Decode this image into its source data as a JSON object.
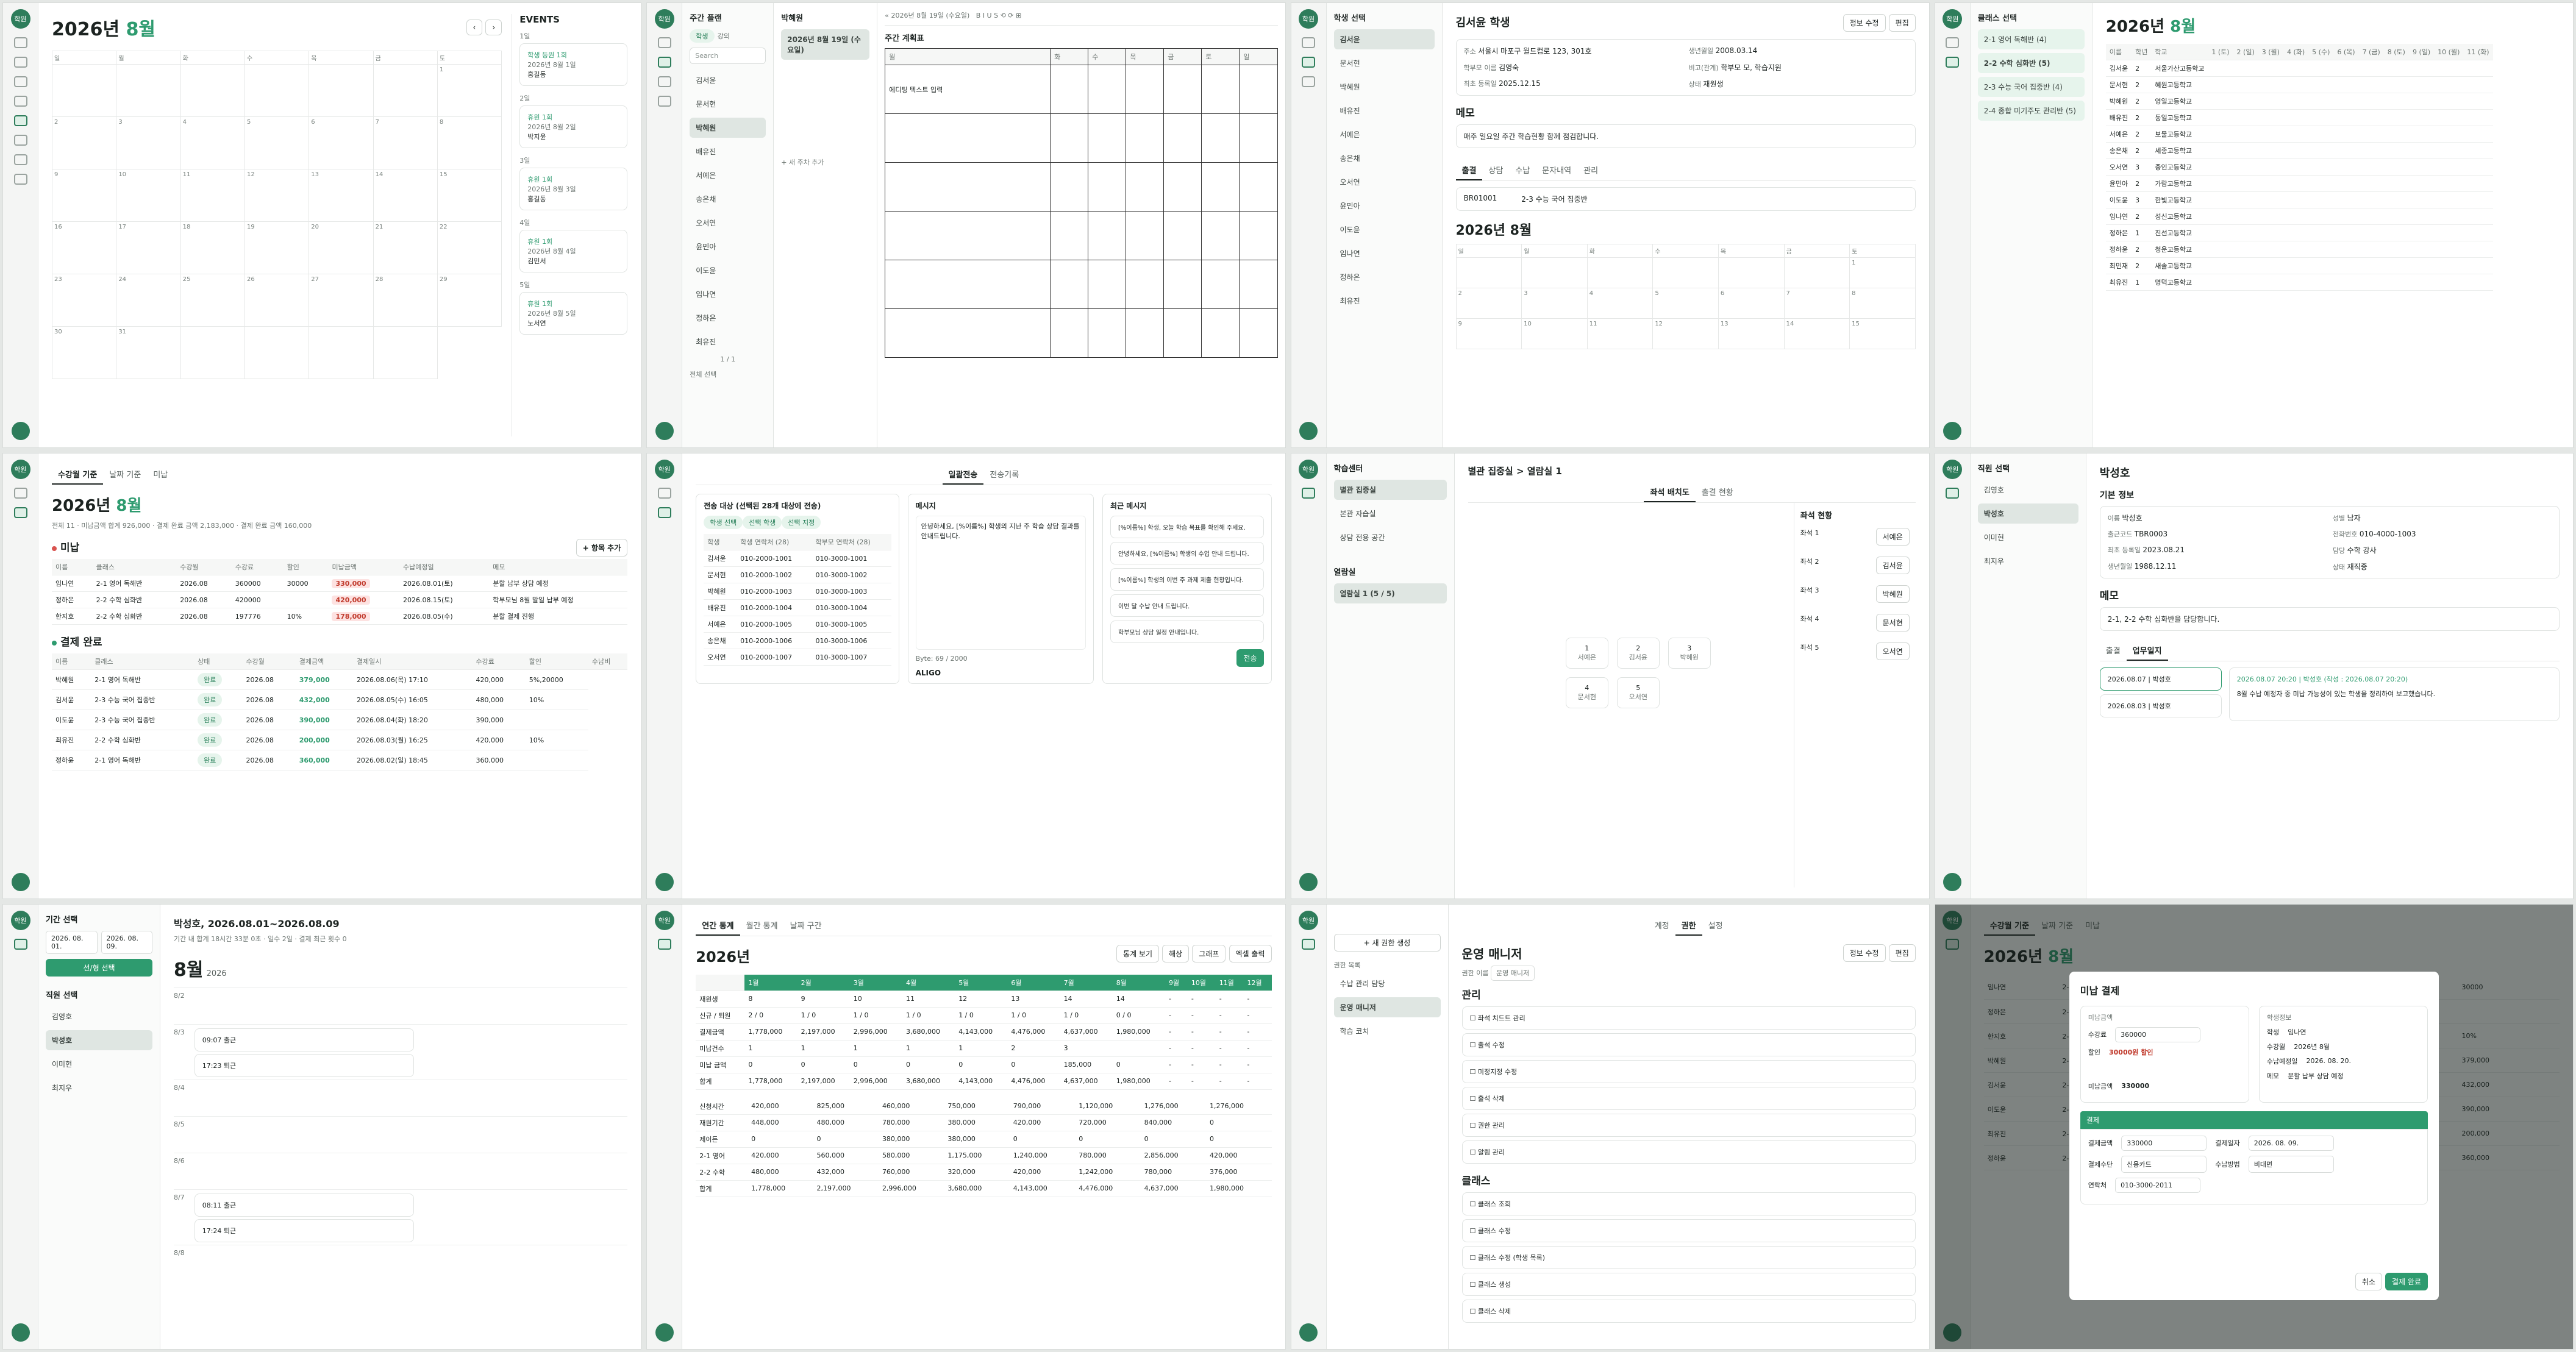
{
  "rail": {
    "logo": "학원"
  },
  "p1": {
    "year": "2026년",
    "month": "8월",
    "events_title": "EVENTS",
    "weekdays": [
      "일",
      "월",
      "화",
      "수",
      "목",
      "금",
      "토"
    ],
    "days": [
      "",
      "",
      "",
      "",
      "",
      "",
      "1",
      "2",
      "3",
      "4",
      "5",
      "6",
      "7",
      "8",
      "9",
      "10",
      "11",
      "12",
      "13",
      "14",
      "15",
      "16",
      "17",
      "18",
      "19",
      "20",
      "21",
      "22",
      "23",
      "24",
      "25",
      "26",
      "27",
      "28",
      "29",
      "30",
      "31",
      "",
      "",
      "",
      ""
    ],
    "events": [
      {
        "date": "1일",
        "name": "학생 등원 1회",
        "when": "2026년 8월 1일",
        "who": "홍길동"
      },
      {
        "date": "2일",
        "name": "휴원 1회",
        "when": "2026년 8월 2일",
        "who": "박지윤"
      },
      {
        "date": "3일",
        "name": "휴원 1회",
        "when": "2026년 8월 3일",
        "who": "홍길동"
      },
      {
        "date": "4일",
        "name": "휴원 1회",
        "when": "2026년 8월 4일",
        "who": "김민서"
      },
      {
        "date": "5일",
        "name": "휴원 1회",
        "when": "2026년 8월 5일",
        "who": "노서연"
      }
    ]
  },
  "p2": {
    "title": "주간 플랜",
    "student": "박혜원",
    "toolbar_date": "2026년 8월 19일 (수요일)",
    "tabs": [
      "학생",
      "강의"
    ],
    "search_placeholder": "Search",
    "students": [
      "김서윤",
      "문서현",
      "박혜원",
      "배유진",
      "서예은",
      "송은채",
      "오서연",
      "윤민아",
      "이도윤",
      "임나연",
      "정하은",
      "최유진"
    ],
    "pager": "1 / 1",
    "plan_title": "주간 계획표",
    "cell_label": "에디팅 텍스트 입력",
    "all_select": "전체 선택",
    "add": "+ 새 주차 추가",
    "days": [
      "월",
      "화",
      "수",
      "목",
      "금",
      "토",
      "일"
    ]
  },
  "p3": {
    "title": "김서윤 학생",
    "side_title": "학생 선택",
    "students": [
      "김서윤",
      "문서현",
      "박혜원",
      "배유진",
      "서예은",
      "송은채",
      "오서연",
      "윤민아",
      "이도윤",
      "임나연",
      "정하은",
      "최유진"
    ],
    "info": [
      {
        "k": "주소",
        "v": "서울시 마포구 월드컵로 123, 301호"
      },
      {
        "k": "생년월일",
        "v": "2008.03.14"
      },
      {
        "k": "학부모 이름",
        "v": "김영숙"
      },
      {
        "k": "비고(관계)",
        "v": "학부모 모, 학습지원"
      },
      {
        "k": "최초 등록일",
        "v": "2025.12.15"
      },
      {
        "k": "상태",
        "v": "재원생"
      }
    ],
    "memo_title": "메모",
    "memo": "매주 일요일 주간 학습현황 함께 점검합니다.",
    "tabs": [
      "출결",
      "상담",
      "수납",
      "문자내역",
      "관리"
    ],
    "code": "BR01001",
    "klass": "2-3 수능 국어 집중반",
    "cal_title": "2026년 8월",
    "btn_edit": "정보 수정",
    "btn_save": "편집"
  },
  "p4": {
    "side_title": "클래스 선택",
    "classes": [
      "2-1 영어 독해반 (4)",
      "2-2 수학 심화반 (5)",
      "2-3 수능 국어 집중반 (4)",
      "2-4 종합 미기주도 관리반 (5)"
    ],
    "title_year": "2026년",
    "title_month": "8월",
    "headers": [
      "이름",
      "학년",
      "학교",
      "1 (토)",
      "2 (일)",
      "3 (월)",
      "4 (화)",
      "5 (수)",
      "6 (목)",
      "7 (금)",
      "8 (토)",
      "9 (일)",
      "10 (월)",
      "11 (화)"
    ],
    "rows": [
      [
        "김서윤",
        "2",
        "서울가산고등학교"
      ],
      [
        "문서현",
        "2",
        "혜원고등학교"
      ],
      [
        "박혜원",
        "2",
        "영일고등학교"
      ],
      [
        "배유진",
        "2",
        "동일고등학교"
      ],
      [
        "서예은",
        "2",
        "보물고등학교"
      ],
      [
        "송은채",
        "2",
        "세종고등학교"
      ],
      [
        "오서연",
        "3",
        "중인고등학교"
      ],
      [
        "윤민아",
        "2",
        "가람고등학교"
      ],
      [
        "이도윤",
        "3",
        "한빛고등학교"
      ],
      [
        "임나연",
        "2",
        "성신고등학교"
      ],
      [
        "정하은",
        "1",
        "진선고등학교"
      ],
      [
        "정하윤",
        "2",
        "청운고등학교"
      ],
      [
        "최민재",
        "2",
        "새솔고등학교"
      ],
      [
        "최유진",
        "1",
        "명덕고등학교"
      ]
    ]
  },
  "p5": {
    "tabs": [
      "수강월 기준",
      "날짜 기준",
      "미납"
    ],
    "title_year": "2026년",
    "title_month": "8월",
    "stats": "전체 11 · 미납금액 합계 926,000 · 결제 완료 금액 2,183,000 · 결제 완료 금액 160,000",
    "unpaid_title": "미납",
    "unpaid_count": "미납 3",
    "headers": [
      "이름",
      "클래스",
      "수강월",
      "수강료",
      "할인",
      "미납금액",
      "수납예정일",
      "메모"
    ],
    "unpaid": [
      [
        "임나연",
        "2-1 영어 독해반",
        "2026.08",
        "360000",
        "30000",
        "330,000",
        "2026.08.01(토)",
        "분할 납부 상담 예정"
      ],
      [
        "정하은",
        "2-2 수학 심화반",
        "2026.08",
        "420000",
        "",
        "420,000",
        "2026.08.15(토)",
        "학부모님 8월 말일 납부 예정"
      ],
      [
        "한지호",
        "2-2 수학 심화반",
        "2026.08",
        "197776",
        "10%",
        "178,000",
        "2026.08.05(수)",
        "분할 결제 진행"
      ]
    ],
    "paid_title": "결제 완료",
    "paid_headers": [
      "이름",
      "클래스",
      "상태",
      "수강월",
      "결제금액",
      "결제일시",
      "수강료",
      "할인",
      "수납비"
    ],
    "paid": [
      [
        "박혜원",
        "2-1 영어 독해반",
        "완료",
        "2026.08",
        "379,000",
        "2026.08.06(목) 17:10",
        "420,000",
        "5%,20000"
      ],
      [
        "김서윤",
        "2-3 수능 국어 집중반",
        "완료",
        "2026.08",
        "432,000",
        "2026.08.05(수) 16:05",
        "480,000",
        "10%"
      ],
      [
        "이도윤",
        "2-3 수능 국어 집중반",
        "완료",
        "2026.08",
        "390,000",
        "2026.08.04(화) 18:20",
        "390,000",
        ""
      ],
      [
        "최유진",
        "2-2 수학 심화반",
        "완료",
        "2026.08",
        "200,000",
        "2026.08.03(월) 16:25",
        "420,000",
        "10%"
      ],
      [
        "정하윤",
        "2-1 영어 독해반",
        "완료",
        "2026.08",
        "360,000",
        "2026.08.02(일) 18:45",
        "360,000",
        ""
      ]
    ],
    "add_btn": "+ 항목 추가"
  },
  "p6": {
    "tabs": [
      "일괄전송",
      "전송기록"
    ],
    "target_title": "전송 대상 (선택된 28개 대상에 전송)",
    "subtabs": [
      "학생 선택",
      "선택 학생",
      "선택 지정"
    ],
    "headers": [
      "학생",
      "학생 연락처 (28)",
      "학부모 연락처 (28)"
    ],
    "rows": [
      [
        "김서윤",
        "010-2000-1001",
        "010-3000-1001"
      ],
      [
        "문서현",
        "010-2000-1002",
        "010-3000-1002"
      ],
      [
        "박혜원",
        "010-2000-1003",
        "010-3000-1003"
      ],
      [
        "배유진",
        "010-2000-1004",
        "010-3000-1004"
      ],
      [
        "서예은",
        "010-2000-1005",
        "010-3000-1005"
      ],
      [
        "송은채",
        "010-2000-1006",
        "010-3000-1006"
      ],
      [
        "오서연",
        "010-2000-1007",
        "010-3000-1007"
      ]
    ],
    "msg_title": "메시지",
    "msg_body": "안녕하세요, [%이름%] 학생의 지난 주 학습 상담 결과를 안내드립니다.",
    "bytes": "Byte: 69 / 2000",
    "aligo": "ALIGO",
    "recent_title": "최근 메시지",
    "recent": [
      "[%이름%] 학생, 오늘 학습 목표를 확인해 주세요.",
      "안녕하세요, [%이름%] 학생의 수업 안내 드립니다.",
      "[%이름%] 학생의 이번 주 과제 제출 현황입니다.",
      "이번 달 수납 안내 드립니다.",
      "학부모님 상담 일정 안내입니다."
    ],
    "send_btn": "전송"
  },
  "p7": {
    "side_title": "학습센터",
    "centers": [
      "별관 집중실",
      "본관 자습실",
      "상담 전용 공간"
    ],
    "breadcrumb": "별관 집중실 > 열람실 1",
    "tabs": [
      "좌석 배치도",
      "출결 현황"
    ],
    "seat_panel": "좌석 현황",
    "seat_rows": [
      "좌석 1",
      "좌석 2",
      "좌석 3",
      "좌석 4",
      "좌석 5"
    ],
    "seat_names": [
      "서예은",
      "김서윤",
      "박혜원",
      "문서현",
      "오서연"
    ],
    "seats": [
      {
        "no": "1",
        "name": "서예은"
      },
      {
        "no": "2",
        "name": "김서윤"
      },
      {
        "no": "3",
        "name": "박혜원"
      },
      {
        "no": "4",
        "name": "문서현"
      },
      {
        "no": "5",
        "name": "오서연"
      }
    ],
    "room_title": "열람실",
    "room": "열람실 1 (5 / 5)"
  },
  "p8": {
    "title": "박성호",
    "side_title": "직원 선택",
    "staff": [
      "김영호",
      "박성호",
      "이미현",
      "최지우"
    ],
    "basic_title": "기본 정보",
    "info": [
      {
        "k": "이름",
        "v": "박성호"
      },
      {
        "k": "성별",
        "v": "남자"
      },
      {
        "k": "출근코드",
        "v": "TBR0003"
      },
      {
        "k": "전화번호",
        "v": "010-4000-1003"
      },
      {
        "k": "최초 등록일",
        "v": "2023.08.21"
      },
      {
        "k": "담당",
        "v": "수학 강사"
      },
      {
        "k": "생년월일",
        "v": "1988.12.11"
      },
      {
        "k": "상태",
        "v": "재직중"
      }
    ],
    "memo_title": "메모",
    "memo": "2-1, 2-2 수학 심화반을 담당합니다.",
    "tabs": [
      "출결",
      "업무일지"
    ],
    "log_date": "2026.08.07 20:20 | 박성호 (작성 : 2026.08.07 20:20)",
    "log_text": "8월 수납 예정자 중 미납 가능성이 있는 학생을 정리하여 보고했습니다.",
    "logs": [
      "2026.08.07 | 박성호",
      "2026.08.03 | 박성호"
    ]
  },
  "p9": {
    "side_title": "기간 선택",
    "start": "2026. 08. 01.",
    "end": "2026. 08. 09.",
    "apply": "선/형 선택",
    "staff_title": "직원 선택",
    "staff": [
      "김영호",
      "박성호",
      "이미현",
      "최지우"
    ],
    "header": "박성호, 2026.08.01~2026.08.09",
    "summary": "기간 내 합계 18시간 33분 0초 · 일수 2일 · 결제 최근 횟수 0",
    "month": "8월",
    "year": "2026",
    "days": [
      "8/2",
      "8/3",
      "8/4",
      "8/5",
      "8/6",
      "8/7",
      "8/8"
    ],
    "entries": [
      {
        "day": "8/3",
        "in": "09:07 출근",
        "out": "17:23 퇴근"
      },
      {
        "day": "8/7",
        "in": "08:11 출근",
        "out": "17:24 퇴근"
      }
    ]
  },
  "p10": {
    "tabs": [
      "연간 통계",
      "월간 통계",
      "날짜 구간"
    ],
    "year": "2026년",
    "months": [
      "1월",
      "2월",
      "3월",
      "4월",
      "5월",
      "6월",
      "7월",
      "8월",
      "9월",
      "10월",
      "11월",
      "12월"
    ],
    "rows": [
      {
        "label": "재원생",
        "vals": [
          "8",
          "9",
          "10",
          "11",
          "12",
          "13",
          "14",
          "14",
          "-",
          "-",
          "-",
          "-"
        ]
      },
      {
        "label": "신규 / 퇴원",
        "vals": [
          "2 / 0",
          "1 / 0",
          "1 / 0",
          "1 / 0",
          "1 / 0",
          "1 / 0",
          "1 / 0",
          "0 / 0",
          "-",
          "-",
          "-",
          "-"
        ]
      },
      {
        "label": "결제금액",
        "vals": [
          "1,778,000",
          "2,197,000",
          "2,996,000",
          "3,680,000",
          "4,143,000",
          "4,476,000",
          "4,637,000",
          "1,980,000",
          "-",
          "-",
          "-",
          "-"
        ]
      },
      {
        "label": "미납건수",
        "vals": [
          "1",
          "1",
          "1",
          "1",
          "1",
          "2",
          "3",
          "",
          "-",
          "-",
          "-",
          "-"
        ]
      },
      {
        "label": "미납 금액",
        "vals": [
          "0",
          "0",
          "0",
          "0",
          "0",
          "0",
          "185,000",
          "0",
          "-",
          "-",
          "-",
          "-"
        ]
      },
      {
        "label": "합계",
        "vals": [
          "1,778,000",
          "2,197,000",
          "2,996,000",
          "3,680,000",
          "4,143,000",
          "4,476,000",
          "4,637,000",
          "1,980,000",
          "-",
          "-",
          "-",
          "-"
        ]
      }
    ],
    "classes": [
      {
        "label": "신청시간",
        "vals": [
          "420,000",
          "825,000",
          "460,000",
          "750,000",
          "790,000",
          "1,120,000",
          "1,276,000",
          "1,276,000"
        ]
      },
      {
        "label": "재원기간",
        "vals": [
          "448,000",
          "480,000",
          "780,000",
          "380,000",
          "420,000",
          "720,000",
          "840,000",
          "0"
        ]
      },
      {
        "label": "제이든",
        "vals": [
          "0",
          "0",
          "380,000",
          "380,000",
          "0",
          "0",
          "0",
          "0"
        ]
      },
      {
        "label": "2-1 영어",
        "vals": [
          "420,000",
          "560,000",
          "580,000",
          "1,175,000",
          "1,240,000",
          "780,000",
          "2,856,000",
          "420,000"
        ]
      },
      {
        "label": "2-2 수학",
        "vals": [
          "480,000",
          "432,000",
          "760,000",
          "320,000",
          "420,000",
          "1,242,000",
          "780,000",
          "376,000"
        ]
      },
      {
        "label": "합계",
        "vals": [
          "1,778,000",
          "2,197,000",
          "2,996,000",
          "3,680,000",
          "4,143,000",
          "4,476,000",
          "4,637,000",
          "1,980,000"
        ]
      }
    ],
    "btn_print": "통계 보기",
    "btn_table": "해상",
    "btn_chart": "그래프",
    "btn_export": "엑셀 출력"
  },
  "p11": {
    "tabs": [
      "계정",
      "권한",
      "설정"
    ],
    "add": "+ 새 권한 생성",
    "roles_title": "권한 목록",
    "roles": [
      "수납 관리 담당",
      "운영 매니저",
      "학습 코치"
    ],
    "title": "운영 매니저",
    "role_name_label": "권한 이름",
    "role_name": "운영 매니저",
    "manage_title": "관리",
    "manage": [
      "좌석 치드트 관리",
      "출석 수정",
      "미정지정 수정",
      "출석 삭제",
      "권한 관리",
      "알림 관리"
    ],
    "class_title": "클래스",
    "class_perms": [
      "클래스 조회",
      "클래스 수정",
      "클래스 수정 (학생 목록)",
      "클래스 생성",
      "클래스 삭제"
    ],
    "btn_edit": "정보 수정",
    "btn_save": "편집"
  },
  "p12": {
    "modal_title": "미납 결제",
    "left_title": "미납금액",
    "amount_label": "수강료",
    "amount": "360000",
    "discount_label": "할인",
    "discount": "30000원 할인",
    "right_title": "학생정보",
    "student_label": "학생",
    "student": "임나연",
    "month_label": "수강월",
    "month": "2026년 8월",
    "due_label": "수납예정일",
    "due": "2026. 08. 20.",
    "memo_label": "메모",
    "memo": "분할 납부 상담 예정",
    "unpaid_label": "미납금액",
    "unpaid": "330000",
    "pay_title": "결제",
    "pay_amount_label": "결제금액",
    "pay_amount": "330000",
    "pay_date_label": "결제일자",
    "pay_date": "2026. 08. 09.",
    "method_label": "결제수단",
    "method": "신용카드",
    "type_label": "수납방법",
    "type": "비대면",
    "phone_label": "연락처",
    "phone": "010-3000-2011",
    "cancel": "취소",
    "confirm": "결제 완료"
  }
}
